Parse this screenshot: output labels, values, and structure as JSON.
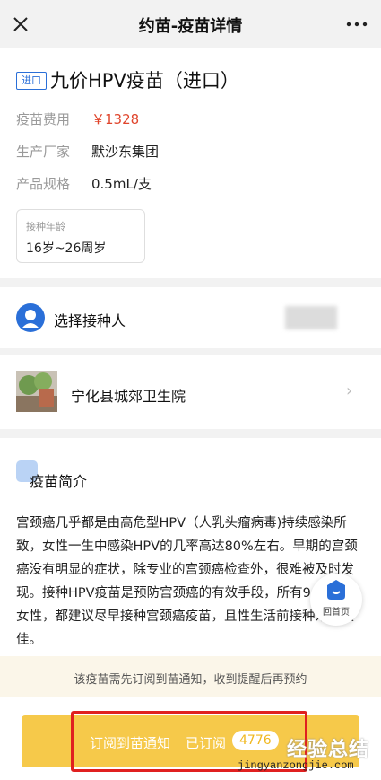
{
  "nav": {
    "title": "约苗-疫苗详情"
  },
  "vaccine": {
    "tag": "进口",
    "name": "九价HPV疫苗（进口）",
    "rows": [
      {
        "label": "疫苗费用",
        "value": "￥1328"
      },
      {
        "label": "生产厂家",
        "value": "默沙东集团"
      },
      {
        "label": "产品规格",
        "value": "0.5mL/支"
      }
    ],
    "age": {
      "label": "接种年龄",
      "value": "16岁~26周岁"
    }
  },
  "person": {
    "label": "选择接种人"
  },
  "clinic": {
    "name": "宁化县城郊卫生院"
  },
  "intro": {
    "title": "疫苗简介",
    "text": "宫颈癌几乎都是由高危型HPV（人乳头瘤病毒)持续感染所致，女性一生中感染HPV的几率高达80%左右。早期的宫颈癌没有明显的症状，除专业的宫颈癌检查外，很难被及时发现。接种HPV疫苗是预防宫颈癌的有效手段，所有9-45岁的女性，都建议尽早接种宫颈癌疫苗，且性生活前接种效果最佳。"
  },
  "home_button": {
    "label": "回首页"
  },
  "notice": {
    "text": "该疫苗需先订阅到苗通知，收到提醒后再预约"
  },
  "subscribe": {
    "label": "订阅到苗通知",
    "subscribed_label": "已订阅",
    "count": "4776"
  },
  "watermark": {
    "text": "经验总结",
    "url": "jingyanzongjie.com"
  },
  "colors": {
    "accent": "#2a6fd8",
    "price": "#e0452c",
    "button": "#f6c94a",
    "highlight_frame": "#e02020"
  }
}
